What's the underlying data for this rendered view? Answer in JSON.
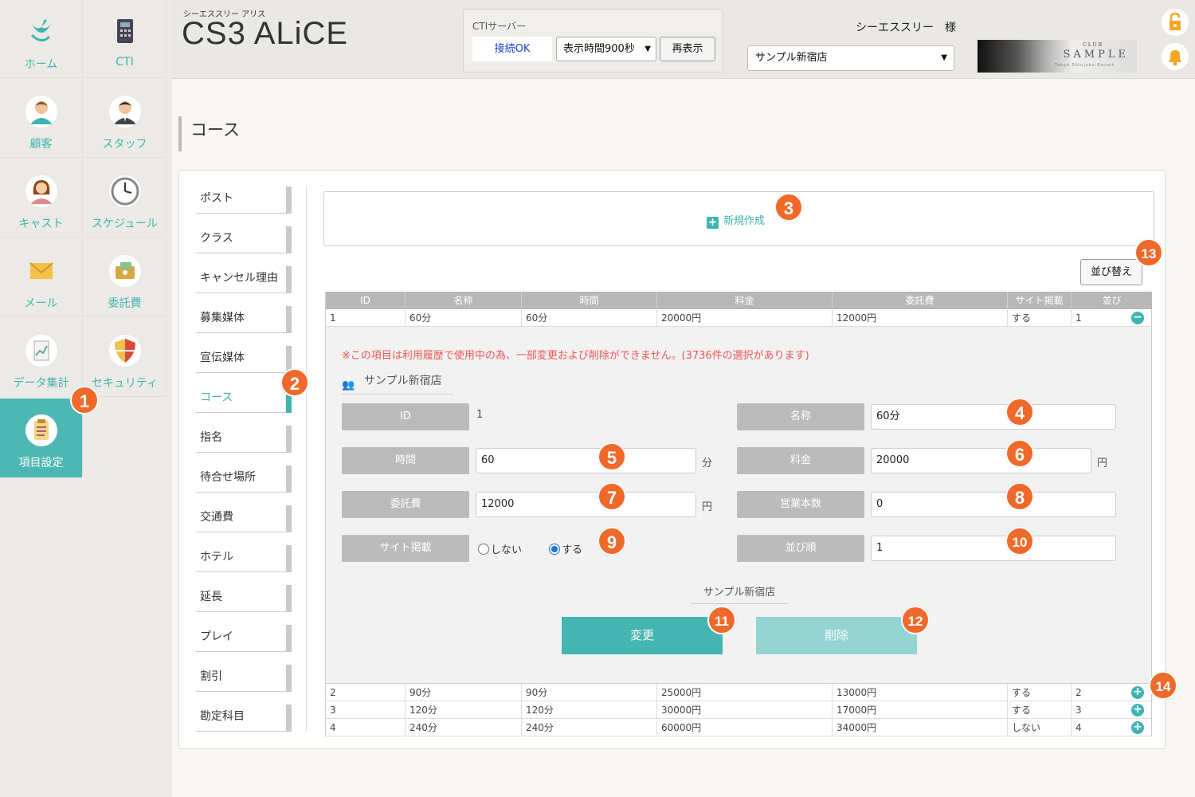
{
  "nav": [
    {
      "label": "ホーム",
      "icon": "tulip-icon"
    },
    {
      "label": "CTI",
      "icon": "phone-icon"
    },
    {
      "label": "顧客",
      "icon": "customer-icon"
    },
    {
      "label": "スタッフ",
      "icon": "staff-icon"
    },
    {
      "label": "キャスト",
      "icon": "cast-icon"
    },
    {
      "label": "スケジュール",
      "icon": "clock-icon"
    },
    {
      "label": "メール",
      "icon": "mail-icon"
    },
    {
      "label": "委託費",
      "icon": "money-icon"
    },
    {
      "label": "データ集計",
      "icon": "chart-icon"
    },
    {
      "label": "セキュリティ",
      "icon": "shield-icon"
    },
    {
      "label": "項目設定",
      "icon": "clipboard-icon",
      "active": true
    }
  ],
  "header": {
    "sub": "シーエススリー アリス",
    "title": "CS3 ALiCE",
    "cti_label": "CTIサーバー",
    "cti_status": "接続OK",
    "display_time": "表示時間900秒",
    "refresh": "再表示",
    "user": "シーエススリー　様",
    "store": "サンプル新宿店",
    "logo_club": "CLUB",
    "logo_sample": "SAMPLE",
    "logo_tag": "Tokyo Shinjuku Escort"
  },
  "page_title": "コース",
  "submenu": [
    "ポスト",
    "クラス",
    "キャンセル理由",
    "募集媒体",
    "宣伝媒体",
    "コース",
    "指名",
    "待合せ場所",
    "交通費",
    "ホテル",
    "延長",
    "プレイ",
    "割引",
    "勘定科目"
  ],
  "submenu_active": 5,
  "new_label": "新規作成",
  "sort_label": "並び替え",
  "table": {
    "headers": [
      "ID",
      "名称",
      "時間",
      "料金",
      "委託費",
      "サイト掲載",
      "並び"
    ],
    "rows": [
      [
        "1",
        "60分",
        "60分",
        "20000円",
        "12000円",
        "する",
        "1"
      ],
      [
        "2",
        "90分",
        "90分",
        "25000円",
        "13000円",
        "する",
        "2"
      ],
      [
        "3",
        "120分",
        "120分",
        "30000円",
        "17000円",
        "する",
        "3"
      ],
      [
        "4",
        "240分",
        "240分",
        "60000円",
        "34000円",
        "しない",
        "4"
      ]
    ]
  },
  "detail": {
    "warning": "※この項目は利用履歴で使用中の為、一部変更および削除ができません。(3736件の選択があります)",
    "store": "サンプル新宿店",
    "id_label": "ID",
    "id_value": "1",
    "name_label": "名称",
    "name_value": "60分",
    "time_label": "時間",
    "time_value": "60",
    "time_unit": "分",
    "price_label": "料金",
    "price_value": "20000",
    "price_unit": "円",
    "fee_label": "委託費",
    "fee_value": "12000",
    "fee_unit": "円",
    "sales_label": "営業本数",
    "sales_value": "0",
    "site_label": "サイト掲載",
    "site_no": "しない",
    "site_yes": "する",
    "order_label": "並び順",
    "order_value": "1",
    "store_foot": "サンプル新宿店",
    "update": "変更",
    "delete": "削除"
  },
  "badges": [
    "1",
    "2",
    "3",
    "4",
    "5",
    "6",
    "7",
    "8",
    "9",
    "10",
    "11",
    "12",
    "13",
    "14"
  ],
  "colors": {
    "accent": "#3fb4b0",
    "badge": "#ef6a2a",
    "warning": "#e55555"
  }
}
